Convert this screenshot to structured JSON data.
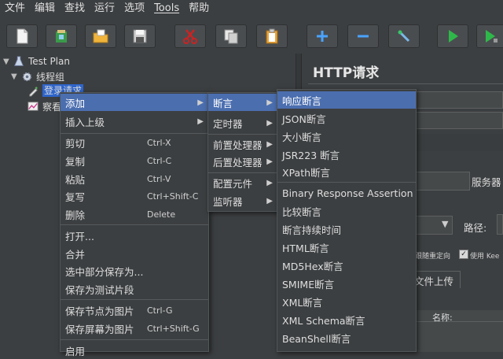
{
  "menubar": [
    "文件",
    "编辑",
    "查找",
    "运行",
    "选项",
    "Tools",
    "帮助"
  ],
  "toolbar": {
    "buttons": [
      "new-icon",
      "templates-icon",
      "open-icon",
      "save-icon",
      "cut-icon",
      "copy-icon",
      "paste-icon",
      "expand-icon",
      "collapse-icon",
      "toggle-icon",
      "start-icon",
      "start-no-pause-icon"
    ]
  },
  "tree": {
    "test_plan": "Test Plan",
    "thread_group": "线程组",
    "request": "登录请求",
    "listener": "察看"
  },
  "right": {
    "title": "HTTP请求",
    "server_label": "服务器",
    "path_label": "路径:",
    "redirect_label": "跟随重定向",
    "keepalive_label": "使用 Kee",
    "upload_tab": "文件上传",
    "name_col": "名称:"
  },
  "context_menu": {
    "items": [
      {
        "label": "添加",
        "shortcut": "",
        "submenu": true
      },
      {
        "label": "插入上级",
        "shortcut": "",
        "submenu": true
      },
      {
        "label": "剪切",
        "shortcut": "Ctrl-X",
        "submenu": false
      },
      {
        "label": "复制",
        "shortcut": "Ctrl-C",
        "submenu": false
      },
      {
        "label": "粘贴",
        "shortcut": "Ctrl-V",
        "submenu": false
      },
      {
        "label": "复写",
        "shortcut": "Ctrl+Shift-C",
        "submenu": false
      },
      {
        "label": "删除",
        "shortcut": "Delete",
        "submenu": false
      },
      {
        "label": "打开...",
        "shortcut": "",
        "submenu": false
      },
      {
        "label": "合并",
        "shortcut": "",
        "submenu": false
      },
      {
        "label": "选中部分保存为...",
        "shortcut": "",
        "submenu": false
      },
      {
        "label": "保存为测试片段",
        "shortcut": "",
        "submenu": false
      },
      {
        "label": "保存节点为图片",
        "shortcut": "Ctrl-G",
        "submenu": false
      },
      {
        "label": "保存屏幕为图片",
        "shortcut": "Ctrl+Shift-G",
        "submenu": false
      },
      {
        "label": "启用",
        "shortcut": "",
        "submenu": false
      }
    ]
  },
  "add_menu": {
    "items": [
      "断言",
      "定时器",
      "前置处理器",
      "后置处理器",
      "配置元件",
      "监听器"
    ]
  },
  "assert_menu": {
    "items": [
      "响应断言",
      "JSON断言",
      "大小断言",
      "JSR223 断言",
      "XPath断言",
      "Binary Response Assertion",
      "比较断言",
      "断言持续时间",
      "HTML断言",
      "MD5Hex断言",
      "SMIME断言",
      "XML断言",
      "XML Schema断言",
      "BeanShell断言"
    ]
  }
}
